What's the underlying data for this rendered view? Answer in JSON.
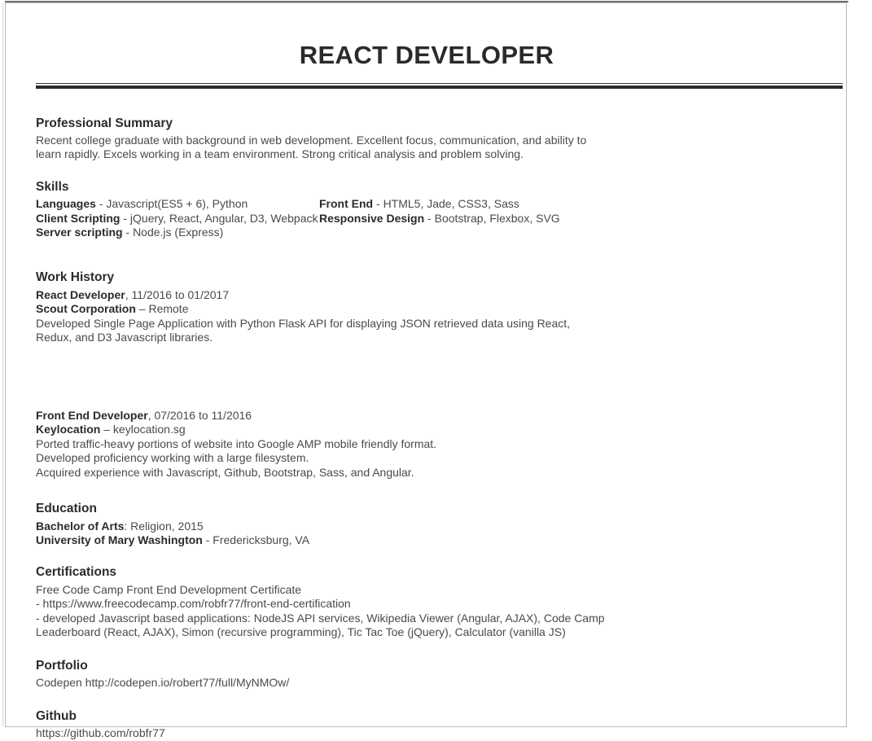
{
  "document": {
    "title": "REACT DEVELOPER"
  },
  "sections": {
    "summary": {
      "heading": "Professional Summary",
      "text": "Recent college graduate with background in web development. Excellent focus, communication, and ability to learn rapidly. Excels working in a team environment. Strong critical analysis and problem solving."
    },
    "skills": {
      "heading": "Skills",
      "left": [
        {
          "label": "Languages",
          "separator": " - ",
          "value": "Javascript(ES5 + 6), Python"
        },
        {
          "label": "Client Scripting",
          "separator": " - ",
          "value": "jQuery, React, Angular, D3, Webpack"
        },
        {
          "label": "Server scripting",
          "separator": " - ",
          "value": "Node.js (Express)"
        }
      ],
      "right": [
        {
          "label": "Front End",
          "separator": " - ",
          "value": "HTML5, Jade, CSS3, Sass"
        },
        {
          "label": "Responsive Design",
          "separator": " - ",
          "value": "Bootstrap, Flexbox, SVG"
        }
      ]
    },
    "work": {
      "heading": "Work History",
      "jobs": [
        {
          "role": "React Developer",
          "dates": ", 11/2016 to 01/2017",
          "company": "Scout Corporation",
          "location": " – Remote",
          "description": "Developed Single Page Application with Python Flask API for displaying JSON retrieved data using React, Redux, and D3 Javascript libraries."
        },
        {
          "role": "Front End Developer",
          "dates": ", 07/2016 to 11/2016",
          "company": "Keylocation",
          "location": " – keylocation.sg",
          "bullets": [
            "Ported traffic-heavy portions of website into Google AMP mobile friendly format.",
            "Developed proficiency working with a large filesystem.",
            "Acquired experience with Javascript, Github, Bootstrap, Sass, and Angular."
          ]
        }
      ]
    },
    "education": {
      "heading": "Education",
      "degree_label": "Bachelor of Arts",
      "degree_value": ": Religion, 2015",
      "school_label": "University of Mary Washington",
      "school_value": " - Fredericksburg, VA"
    },
    "certifications": {
      "heading": "Certifications",
      "lines": [
        "Free Code Camp Front End Development Certificate",
        "- https://www.freecodecamp.com/robfr77/front-end-certification",
        "- developed Javascript based applications: NodeJS API services, Wikipedia Viewer (Angular, AJAX), Code Camp Leaderboard (React, AJAX), Simon (recursive programming), Tic Tac Toe (jQuery), Calculator (vanilla JS)"
      ]
    },
    "portfolio": {
      "heading": "Portfolio",
      "text": "Codepen http://codepen.io/robert77/full/MyNMOw/"
    },
    "github": {
      "heading": "Github",
      "text": "https://github.com/robfr77"
    }
  },
  "colors": {
    "heading": "#2b2b2b",
    "body": "#4a4a4a",
    "rule": "#2a2a2a",
    "page_border": "#b8b8b8"
  }
}
